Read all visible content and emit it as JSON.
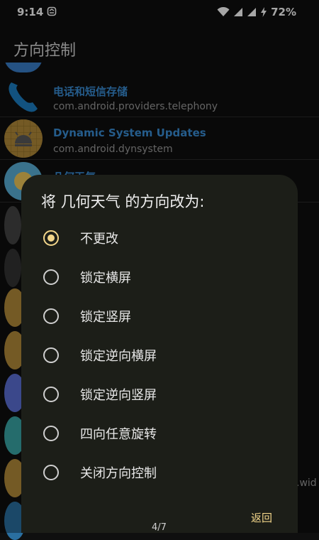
{
  "status_bar": {
    "time": "9:14",
    "battery": "72%"
  },
  "app_bar": {
    "title": "方向控制"
  },
  "list": {
    "items": [
      {
        "name": "电话和短信存储",
        "package": "com.android.providers.telephony",
        "icon": "phone-icon"
      },
      {
        "name": "Dynamic System Updates",
        "package": "com.android.dynsystem",
        "icon": "android-icon"
      },
      {
        "name": "几何天气",
        "package": "",
        "icon": "weather-icon"
      }
    ],
    "behind_text": ".wid"
  },
  "dialog": {
    "title": "将 几何天气 的方向改为:",
    "options": [
      {
        "label": "不更改",
        "checked": true
      },
      {
        "label": "锁定横屏",
        "checked": false
      },
      {
        "label": "锁定竖屏",
        "checked": false
      },
      {
        "label": "锁定逆向横屏",
        "checked": false
      },
      {
        "label": "锁定逆向竖屏",
        "checked": false
      },
      {
        "label": "四向任意旋转",
        "checked": false
      },
      {
        "label": "关闭方向控制",
        "checked": false
      }
    ],
    "back_label": "返回",
    "page_indicator": "4/7"
  },
  "colors": {
    "accent": "#f3d68a",
    "link_blue": "#3a8ed6",
    "dialog_bg": "#1c1e18"
  }
}
